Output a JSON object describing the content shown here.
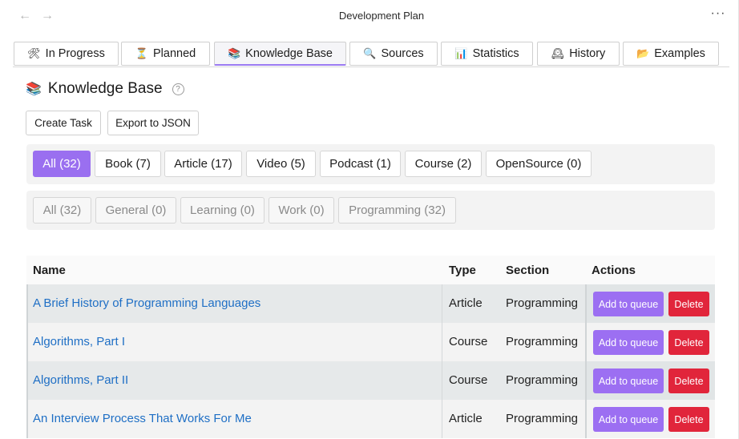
{
  "window": {
    "title": "Development Plan",
    "back_glyph": "←",
    "forward_glyph": "→",
    "more_glyph": "···"
  },
  "tabs": [
    {
      "icon": "🛠",
      "icon_name": "tools-icon",
      "label": "In Progress"
    },
    {
      "icon": "⏳",
      "icon_name": "hourglass-icon",
      "label": "Planned"
    },
    {
      "icon": "📚",
      "icon_name": "books-icon",
      "label": "Knowledge Base",
      "active": true
    },
    {
      "icon": "🔍",
      "icon_name": "magnifier-icon",
      "label": "Sources"
    },
    {
      "icon": "📊",
      "icon_name": "bar-chart-icon",
      "label": "Statistics"
    },
    {
      "icon": "🕰",
      "icon_name": "clock-icon",
      "label": "History"
    },
    {
      "icon": "📂",
      "icon_name": "folder-icon",
      "label": "Examples"
    }
  ],
  "page": {
    "icon": "📚",
    "title": "Knowledge Base",
    "help_glyph": "?"
  },
  "actions": {
    "create_task": "Create Task",
    "export_json": "Export to JSON"
  },
  "type_filters": [
    {
      "label": "All (32)",
      "active": true
    },
    {
      "label": "Book (7)"
    },
    {
      "label": "Article (17)"
    },
    {
      "label": "Video (5)"
    },
    {
      "label": "Podcast (1)"
    },
    {
      "label": "Course (2)"
    },
    {
      "label": "OpenSource (0)"
    }
  ],
  "section_filters": [
    {
      "label": "All (32)"
    },
    {
      "label": "General (0)"
    },
    {
      "label": "Learning (0)"
    },
    {
      "label": "Work (0)"
    },
    {
      "label": "Programming (32)"
    }
  ],
  "table": {
    "headers": {
      "name": "Name",
      "type": "Type",
      "section": "Section",
      "actions": "Actions"
    },
    "rows": [
      {
        "name": "A Brief History of Programming Languages",
        "type": "Article",
        "section": "Programming"
      },
      {
        "name": "Algorithms, Part I",
        "type": "Course",
        "section": "Programming"
      },
      {
        "name": "Algorithms, Part II",
        "type": "Course",
        "section": "Programming"
      },
      {
        "name": "An Interview Process That Works For Me",
        "type": "Article",
        "section": "Programming"
      }
    ],
    "queue_label": "Add to queue",
    "delete_label": "Delete"
  },
  "colors": {
    "accent": "#9a6ff0",
    "danger": "#e1253b",
    "link": "#1f6fc5"
  }
}
